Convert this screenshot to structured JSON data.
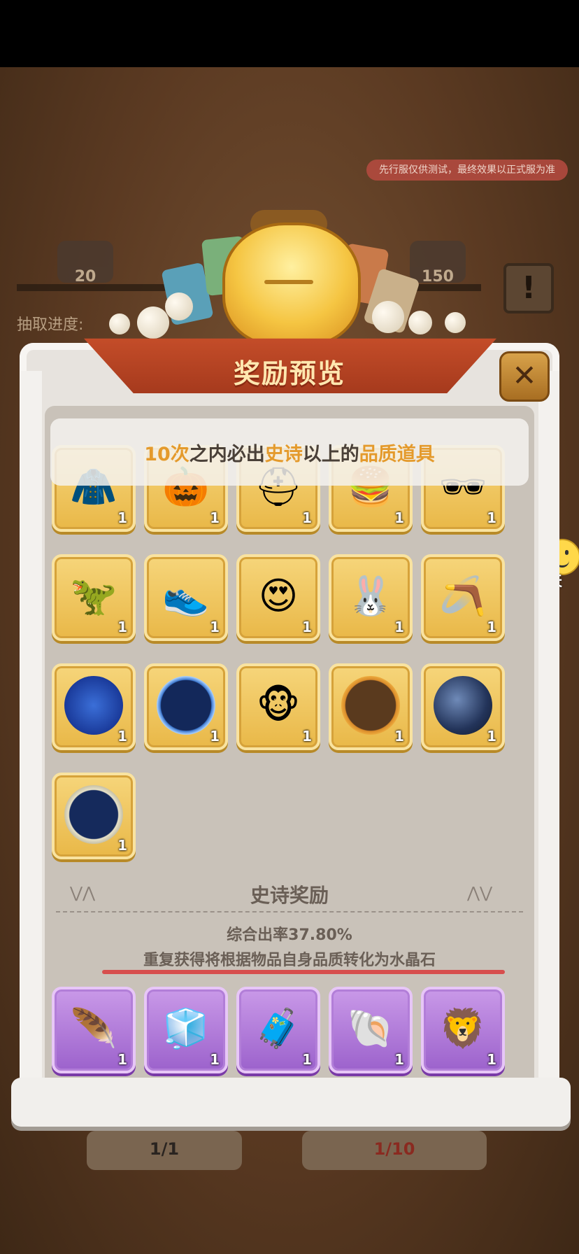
{
  "test_notice": "先行服仅供测试，最终效果以正式服为准",
  "background": {
    "chest_left_count": "20",
    "chest_right_count": "150",
    "progress_label": "抽取进度:",
    "scroll_icon": "!"
  },
  "chat": {
    "label": "聊天"
  },
  "panel": {
    "title": "奖励预览",
    "close_icon": "✕",
    "hint": {
      "part1": "10次",
      "part2": "之内必出",
      "part3": "史诗",
      "part4": "以上的",
      "part5": "品质道具"
    }
  },
  "legendary_items": [
    {
      "name": "yellow-jacket",
      "qty": "1"
    },
    {
      "name": "pumpkin-bat-staff",
      "qty": "1"
    },
    {
      "name": "helmet",
      "qty": "1"
    },
    {
      "name": "burger-food",
      "qty": "1"
    },
    {
      "name": "pixel-sunglasses",
      "qty": "1"
    },
    {
      "name": "dino-pet",
      "qty": "1"
    },
    {
      "name": "red-sneaker",
      "qty": "1"
    },
    {
      "name": "heart-eyes-emote",
      "qty": "1"
    },
    {
      "name": "bunny-robot",
      "qty": "1"
    },
    {
      "name": "slingshot",
      "qty": "1"
    },
    {
      "name": "constellation-orb",
      "qty": "1"
    },
    {
      "name": "blue-portal-frame",
      "qty": "1"
    },
    {
      "name": "monkey-sticker",
      "qty": "1"
    },
    {
      "name": "autumn-leaf-frame",
      "qty": "1"
    },
    {
      "name": "space-helmet-orb",
      "qty": "1"
    },
    {
      "name": "cloud-gold-frame",
      "qty": "1"
    }
  ],
  "epic_section": {
    "title": "史诗奖励",
    "rate": "综合出率37.80%",
    "convert_note": "重复获得将根据物品自身品质转化为水晶石"
  },
  "epic_items": [
    {
      "name": "feather-net",
      "qty": "1"
    },
    {
      "name": "ice-cubes",
      "qty": "1"
    },
    {
      "name": "suitcase",
      "qty": "1"
    },
    {
      "name": "white-shell",
      "qty": "1"
    },
    {
      "name": "lion-dance-ticket",
      "qty": "1"
    }
  ],
  "bottom": {
    "left_progress": "1/1",
    "right_progress": "1/10"
  },
  "colors": {
    "legendary_bg": "#e9b848",
    "epic_bg": "#9c62cc",
    "hint_highlight": "#e49a2c",
    "ribbon": "#b8441f"
  }
}
